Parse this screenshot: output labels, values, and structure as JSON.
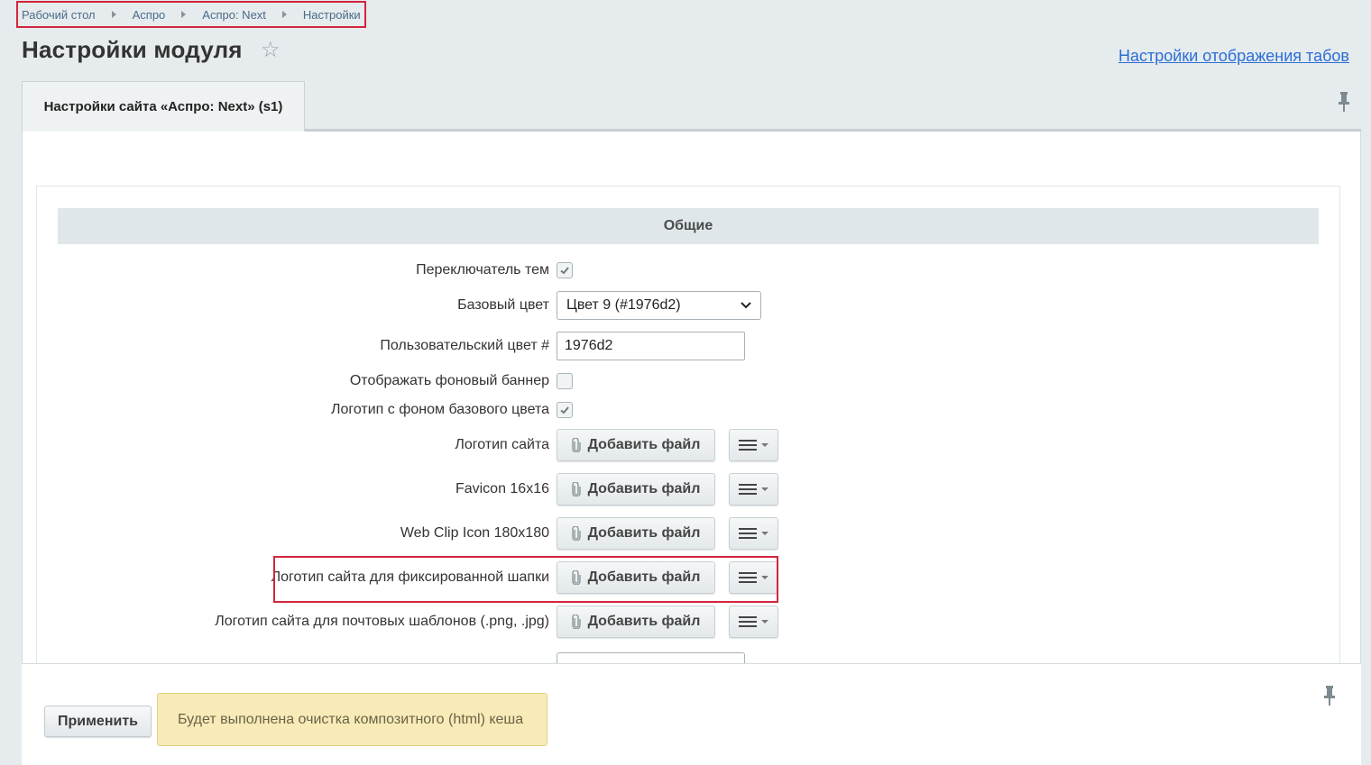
{
  "breadcrumb": [
    "Рабочий стол",
    "Аспро",
    "Аспро: Next",
    "Настройки"
  ],
  "page": {
    "title": "Настройки модуля",
    "tab_settings_link": "Настройки отображения табов"
  },
  "tabs": [
    {
      "label": "Настройки сайта «Аспро: Next» (s1)",
      "active": true
    }
  ],
  "section": {
    "title": "Общие"
  },
  "fields": {
    "theme_switcher": {
      "label": "Переключатель тем",
      "checked": true
    },
    "base_color": {
      "label": "Базовый цвет",
      "value": "Цвет 9 (#1976d2)"
    },
    "custom_color": {
      "label": "Пользовательский цвет #",
      "value": "1976d2"
    },
    "bg_banner": {
      "label": "Отображать фоновый баннер",
      "checked": false
    },
    "logo_bg": {
      "label": "Логотип с фоном базового цвета",
      "checked": true
    },
    "site_logo": {
      "label": "Логотип сайта"
    },
    "favicon": {
      "label": "Favicon 16x16"
    },
    "webclip": {
      "label": "Web Clip Icon 180x180"
    },
    "fixed_logo": {
      "label": "Логотип сайта для фиксированной шапки"
    },
    "mail_logo": {
      "label": "Логотип сайта для почтовых шаблонов (.png, .jpg)"
    }
  },
  "buttons": {
    "add_file": "Добавить файл",
    "apply": "Применить"
  },
  "notice": "Будет выполнена очистка композитного (html) кеша",
  "colors": {
    "highlight": "#d3263d",
    "link": "#2b6fd6",
    "notice_bg": "#f8ebb8"
  },
  "icons": [
    "star-icon",
    "pin-icon",
    "check-icon",
    "chevron-down-icon",
    "paperclip-icon",
    "menu-icon"
  ]
}
